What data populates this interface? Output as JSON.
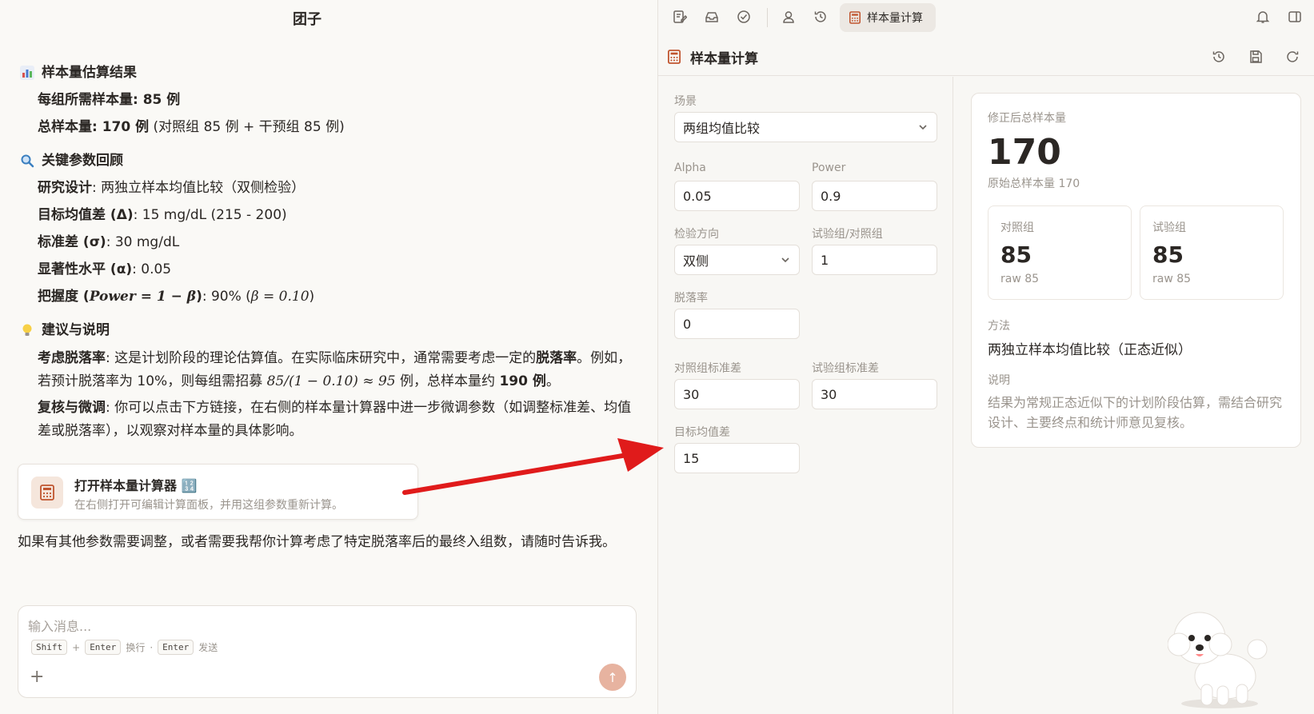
{
  "chat": {
    "title": "团子",
    "sections": {
      "result": {
        "icon": "bar-chart-icon",
        "title": "样本量估算结果",
        "per_group_label": "每组所需样本量",
        "per_group_value": ": 85 例",
        "total_label": "总样本量",
        "total_value": ": 170 例",
        "total_detail": " (对照组 85 例 + 干预组 85 例)"
      },
      "params": {
        "icon": "magnifier-icon",
        "title": "关键参数回顾",
        "design_label": "研究设计",
        "design_value": ": 两独立样本均值比较（双侧检验）",
        "diff_label": "目标均值差 (Δ)",
        "diff_value": ": 15 mg/dL (215 - 200)",
        "sd_label": "标准差 (σ)",
        "sd_value": ": 30 mg/dL",
        "alpha_label": "显著性水平 (α)",
        "alpha_value": ": 0.05",
        "power_label": "把握度 (",
        "power_math": "Power = 1 − β",
        "power_close": ")",
        "power_value": ": 90% (",
        "power_beta": "β = 0.10",
        "power_end": ")"
      },
      "advice": {
        "icon": "lightbulb-icon",
        "title": "建议与说明",
        "dropout_label": "考虑脱落率",
        "dropout_text_1": ": 这是计划阶段的理论估算值。在实际临床研究中，通常需要考虑一定的",
        "dropout_bold": "脱落率",
        "dropout_text_2": "。例如，若预计脱落率为 10%，则每组需招募 ",
        "dropout_math": "85/(1 − 0.10) ≈ 95",
        "dropout_text_3": " 例，总样本量约 ",
        "dropout_bold_2": "190 例",
        "dropout_text_4": "。",
        "tune_label": "复核与微调",
        "tune_text": ": 你可以点击下方链接，在右侧的样本量计算器中进一步微调参数（如调整标准差、均值差或脱落率），以观察对样本量的具体影响。"
      }
    },
    "card": {
      "icon": "calculator-icon",
      "title": "打开样本量计算器 🔢",
      "subtitle": "在右侧打开可编辑计算面板，并用这组参数重新计算。"
    },
    "followup": "如果有其他参数需要调整，或者需要我帮你计算考虑了特定脱落率后的最终入组数，请随时告诉我。",
    "composer": {
      "placeholder": "输入消息...",
      "key_shift": "Shift",
      "plus_sign": "+",
      "key_enter": "Enter",
      "newline_label": "换行",
      "dot": "·",
      "key_enter_2": "Enter",
      "send_label": "发送",
      "add_symbol": "+",
      "send_symbol": "↑"
    }
  },
  "panel": {
    "active_tab": "样本量计算",
    "title": "样本量计算",
    "form": {
      "scenario_label": "场景",
      "scenario_value": "两组均值比较",
      "alpha_label": "Alpha",
      "alpha_value": "0.05",
      "power_label": "Power",
      "power_value": "0.9",
      "direction_label": "检验方向",
      "direction_value": "双侧",
      "ratio_label": "试验组/对照组",
      "ratio_value": "1",
      "dropout_label": "脱落率",
      "dropout_value": "0",
      "control_sd_label": "对照组标准差",
      "control_sd_value": "30",
      "trial_sd_label": "试验组标准差",
      "trial_sd_value": "30",
      "target_diff_label": "目标均值差",
      "target_diff_value": "15"
    },
    "result": {
      "corrected_total_label": "修正后总样本量",
      "corrected_total_value": "170",
      "raw_total_text": "原始总样本量 170",
      "control_label": "对照组",
      "control_value": "85",
      "control_raw": "raw 85",
      "trial_label": "试验组",
      "trial_value": "85",
      "trial_raw": "raw 85",
      "method_label": "方法",
      "method_value": "两独立样本均值比较（正态近似）",
      "note_label": "说明",
      "note_value": "结果为常规正态近似下的计划阶段估算，需结合研究设计、主要终点和统计师意见复核。"
    }
  },
  "colors": {
    "accent": "#c0552f",
    "arrow": "#e01b1b",
    "send_button": "#e7b3a0"
  }
}
